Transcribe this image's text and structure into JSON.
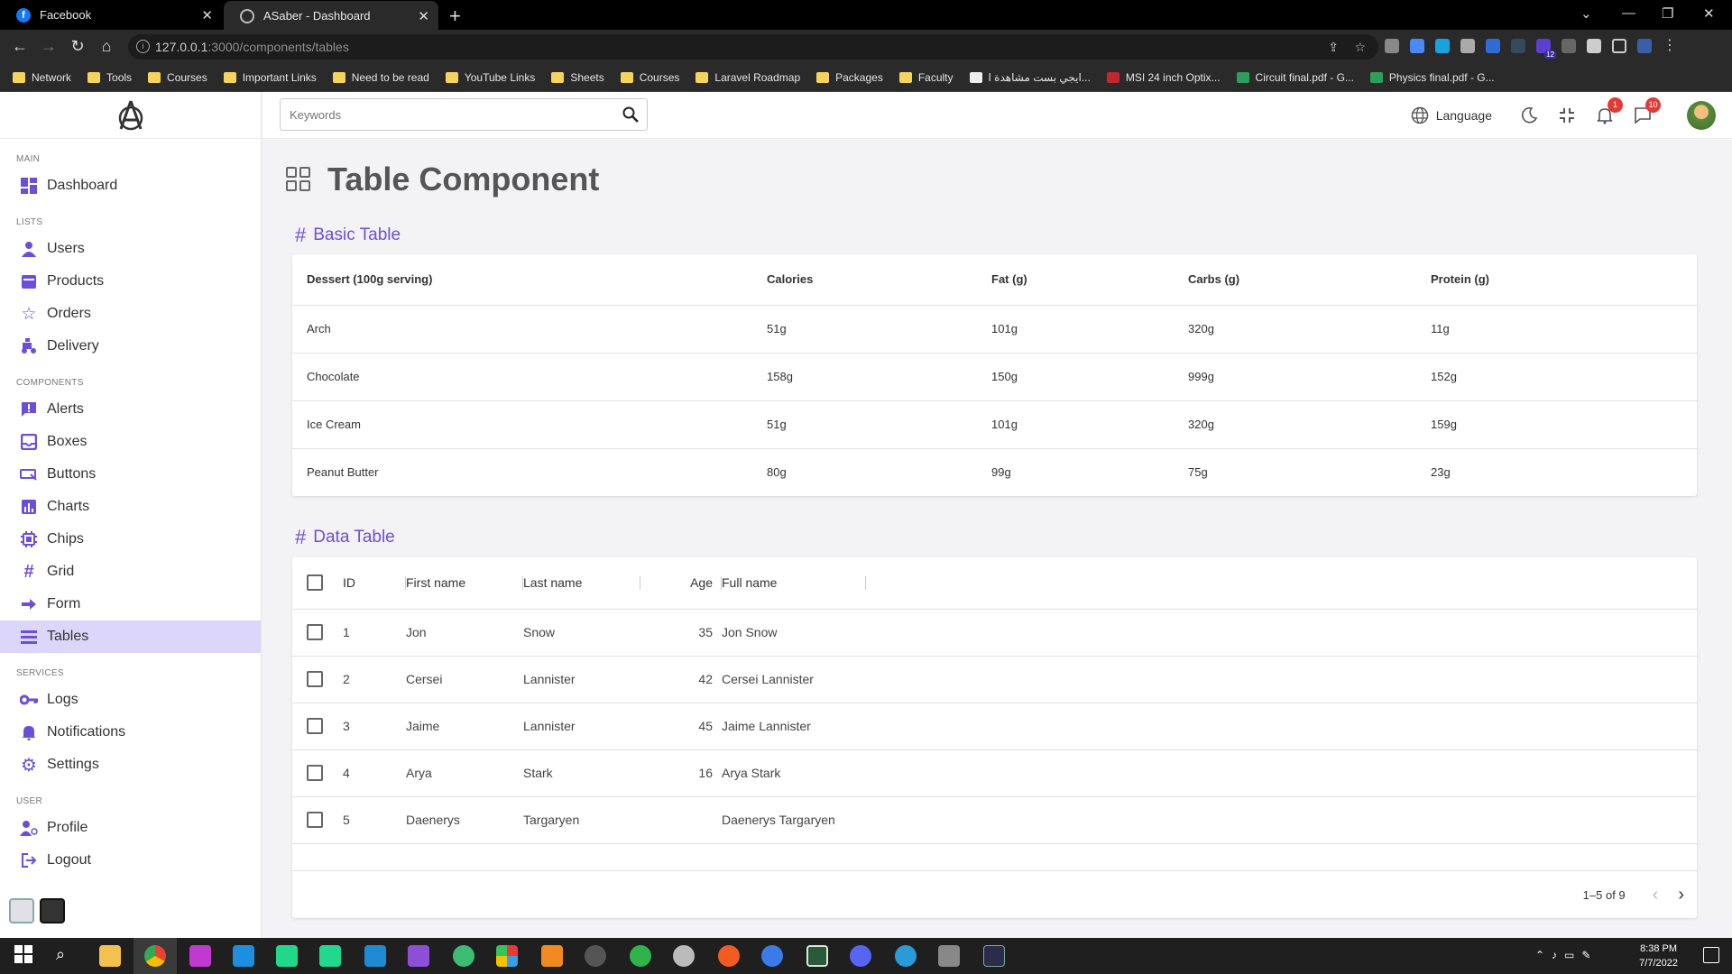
{
  "browser": {
    "tabs": [
      {
        "title": "Facebook",
        "icon": "facebook-icon"
      },
      {
        "title": "ASaber - Dashboard",
        "icon": "globe-icon"
      }
    ],
    "url_host": "127.0.0.1",
    "url_path": ":3000/components/tables",
    "bookmarks": [
      "Network",
      "Tools",
      "Courses",
      "Important Links",
      "Need to be read",
      "YouTube Links",
      "Sheets",
      "Courses",
      "Laravel Roadmap",
      "Packages",
      "Faculty",
      "ايجي بست مشاهدة ا...",
      "MSI 24 inch Optix...",
      "Circuit final.pdf - G...",
      "Physics final.pdf - G..."
    ],
    "ext_badge": "12"
  },
  "search": {
    "placeholder": "Keywords"
  },
  "topbar": {
    "language_label": "Language",
    "notifications_count": "1",
    "messages_count": "10"
  },
  "sidebar": {
    "sections": [
      {
        "title": "MAIN",
        "items": [
          {
            "label": "Dashboard",
            "icon": "dashboard-icon"
          }
        ]
      },
      {
        "title": "LISTS",
        "items": [
          {
            "label": "Users",
            "icon": "user-icon"
          },
          {
            "label": "Products",
            "icon": "box-icon"
          },
          {
            "label": "Orders",
            "icon": "star-icon"
          },
          {
            "label": "Delivery",
            "icon": "delivery-icon"
          }
        ]
      },
      {
        "title": "COMPONENTS",
        "items": [
          {
            "label": "Alerts",
            "icon": "alert-icon"
          },
          {
            "label": "Boxes",
            "icon": "inbox-icon"
          },
          {
            "label": "Buttons",
            "icon": "button-icon"
          },
          {
            "label": "Charts",
            "icon": "chart-icon"
          },
          {
            "label": "Chips",
            "icon": "chip-icon"
          },
          {
            "label": "Grid",
            "icon": "grid-icon"
          },
          {
            "label": "Form",
            "icon": "arrow-right-icon"
          },
          {
            "label": "Tables",
            "icon": "list-icon",
            "active": true
          }
        ]
      },
      {
        "title": "SERVICES",
        "items": [
          {
            "label": "Logs",
            "icon": "key-icon"
          },
          {
            "label": "Notifications",
            "icon": "bell-icon"
          },
          {
            "label": "Settings",
            "icon": "gear-icon"
          }
        ]
      },
      {
        "title": "USER",
        "items": [
          {
            "label": "Profile",
            "icon": "profile-icon"
          },
          {
            "label": "Logout",
            "icon": "logout-icon"
          }
        ]
      }
    ]
  },
  "page": {
    "title": "Table Component"
  },
  "basic_table": {
    "title": "Basic Table",
    "headers": [
      "Dessert (100g serving)",
      "Calories",
      "Fat (g)",
      "Carbs (g)",
      "Protein (g)"
    ],
    "rows": [
      [
        "Arch",
        "51g",
        "101g",
        "320g",
        "11g"
      ],
      [
        "Chocolate",
        "158g",
        "150g",
        "999g",
        "152g"
      ],
      [
        "Ice Cream",
        "51g",
        "101g",
        "320g",
        "159g"
      ],
      [
        "Peanut Butter",
        "80g",
        "99g",
        "75g",
        "23g"
      ]
    ]
  },
  "data_table": {
    "title": "Data Table",
    "headers": [
      "ID",
      "First name",
      "Last name",
      "Age",
      "Full name"
    ],
    "rows": [
      [
        "1",
        "Jon",
        "Snow",
        "35",
        "Jon Snow"
      ],
      [
        "2",
        "Cersei",
        "Lannister",
        "42",
        "Cersei Lannister"
      ],
      [
        "3",
        "Jaime",
        "Lannister",
        "45",
        "Jaime Lannister"
      ],
      [
        "4",
        "Arya",
        "Stark",
        "16",
        "Arya Stark"
      ],
      [
        "5",
        "Daenerys",
        "Targaryen",
        "",
        "Daenerys Targaryen"
      ]
    ],
    "pagination": "1–5 of 9"
  },
  "taskbar": {
    "time": "8:38 PM",
    "date": "7/7/2022"
  },
  "colors": {
    "accent": "#6c4fd9",
    "active_bg": "#dcd6fb"
  }
}
